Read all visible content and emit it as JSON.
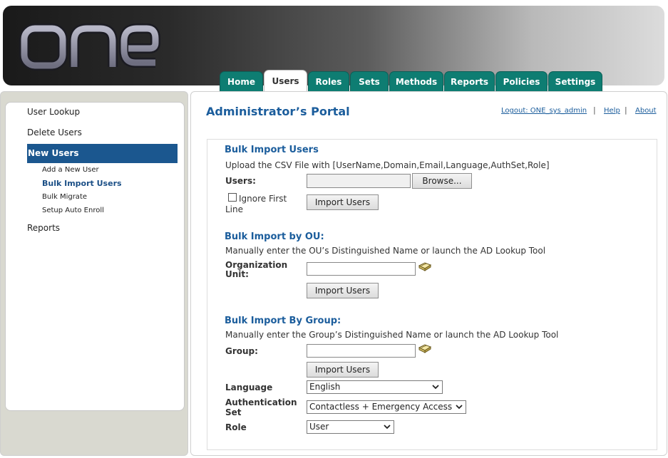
{
  "logo_text": "one",
  "tabs": [
    "Home",
    "Users",
    "Roles",
    "Sets",
    "Methods",
    "Reports",
    "Policies",
    "Settings"
  ],
  "active_tab": "Users",
  "sidebar": {
    "items": [
      "User Lookup",
      "Delete Users",
      "New Users",
      "Reports"
    ],
    "selected": "New Users",
    "subitems": [
      "Add a New User",
      "Bulk Import Users",
      "Bulk Migrate",
      "Setup Auto Enroll"
    ],
    "current_subitem": "Bulk Import Users"
  },
  "main": {
    "title": "Administrator’s Portal",
    "links": {
      "logout": "Logout: ONE_sys_admin",
      "help": "Help",
      "about": "About"
    },
    "bulk_users": {
      "heading": "Bulk Import Users",
      "instructions": "Upload the CSV File with [UserName,Domain,Email,Language,AuthSet,Role]",
      "users_label": "Users:",
      "browse": "Browse...",
      "ignore_line1": "Ignore First",
      "ignore_line2": "Line",
      "import": "Import Users"
    },
    "bulk_ou": {
      "heading": "Bulk Import by OU:",
      "instructions": "Manually enter the OU’s Distinguished Name or launch the AD Lookup Tool",
      "label_line1": "Organization",
      "label_line2": "Unit:",
      "value": "",
      "import": "Import Users"
    },
    "bulk_group": {
      "heading": "Bulk Import By Group:",
      "instructions": "Manually enter the Group’s Distinguished Name or launch the AD Lookup Tool",
      "label": "Group:",
      "value": "",
      "import": "Import Users"
    },
    "language": {
      "label": "Language",
      "value": "English"
    },
    "auth_set": {
      "label_line1": "Authentication",
      "label_line2": "Set",
      "value": "Contactless + Emergency Access"
    },
    "role": {
      "label": "Role",
      "value": "User"
    }
  },
  "colors": {
    "tab": "#0e7d72",
    "selected_nav": "#1b578f",
    "heading": "#1b5d9c"
  }
}
